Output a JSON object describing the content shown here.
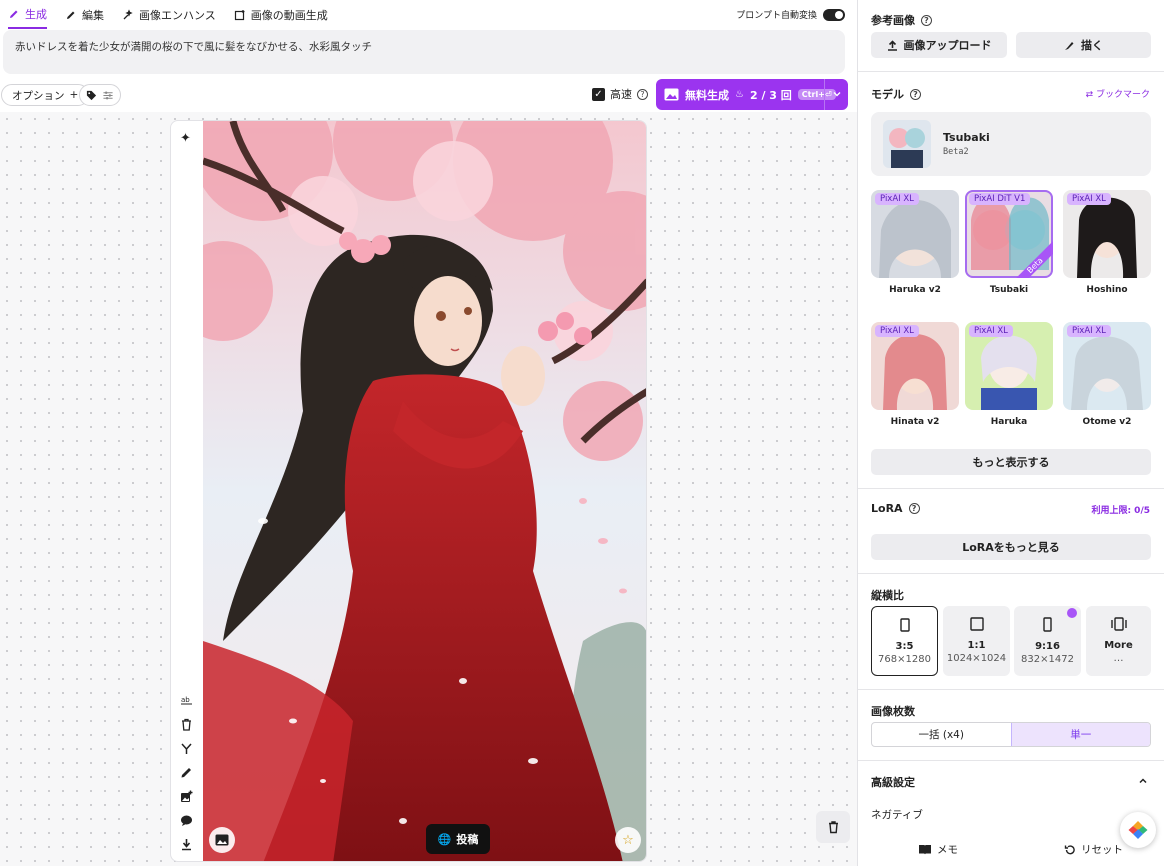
{
  "tabs": [
    {
      "label": "生成",
      "icon": "pencil-icon",
      "active": true
    },
    {
      "label": "編集",
      "icon": "edit-icon",
      "active": false
    },
    {
      "label": "画像エンハンス",
      "icon": "enhance-icon",
      "active": false
    },
    {
      "label": "画像の動画生成",
      "icon": "video-gen-icon",
      "active": false
    }
  ],
  "auto_convert_label": "プロンプト自動変換",
  "prompt_text": "赤いドレスを着た少女が満開の桜の下で風に髪をなびかせる、水彩風タッチ",
  "options_label": "オプション",
  "fast_label": "高速",
  "generate": {
    "label": "無料生成",
    "count": "2 / 3 回",
    "shortcut": "Ctrl+⏎"
  },
  "image_card": {
    "post_label": "投稿",
    "tools": [
      "text-icon",
      "trash-icon",
      "branch-icon",
      "pencil-icon",
      "add-image-icon",
      "comment-icon",
      "download-icon"
    ]
  },
  "right": {
    "reference": {
      "title": "参考画像",
      "upload_label": "画像アップロード",
      "draw_label": "描く"
    },
    "model": {
      "title": "モデル",
      "bookmark_label": "ブックマーク",
      "current_name": "Tsubaki",
      "current_version": "Beta2",
      "items": [
        {
          "name": "Haruka v2",
          "badge": "PixAI XL",
          "selected": false
        },
        {
          "name": "Tsubaki",
          "badge": "PixAI DiT V1",
          "selected": true,
          "ribbon": "Beta"
        },
        {
          "name": "Hoshino",
          "badge": "PixAI XL",
          "selected": false
        },
        {
          "name": "Hinata v2",
          "badge": "PixAI XL",
          "selected": false
        },
        {
          "name": "Haruka",
          "badge": "PixAI XL",
          "selected": false
        },
        {
          "name": "Otome v2",
          "badge": "PixAI XL",
          "selected": false
        }
      ],
      "more_label": "もっと表示する"
    },
    "lora": {
      "title": "LoRA",
      "limit": "利用上限: 0/5",
      "more_label": "LoRAをもっと見る"
    },
    "aspect": {
      "title": "縦横比",
      "items": [
        {
          "ratio": "3:5",
          "dims": "768×1280",
          "selected": true
        },
        {
          "ratio": "1:1",
          "dims": "1024×1024",
          "selected": false
        },
        {
          "ratio": "9:16",
          "dims": "832×1472",
          "selected": false
        },
        {
          "ratio": "More",
          "dims": "…",
          "selected": false
        }
      ]
    },
    "count": {
      "title": "画像枚数",
      "options": [
        "一括 (x4)",
        "単一"
      ],
      "selected": "単一"
    },
    "advanced": {
      "title": "高級設定",
      "negative_label": "ネガティブ"
    },
    "footer": {
      "memo_label": "メモ",
      "reset_label": "リセット"
    }
  },
  "colors": {
    "accent": "#9b34ef",
    "accent_light": "#ede3fd"
  }
}
